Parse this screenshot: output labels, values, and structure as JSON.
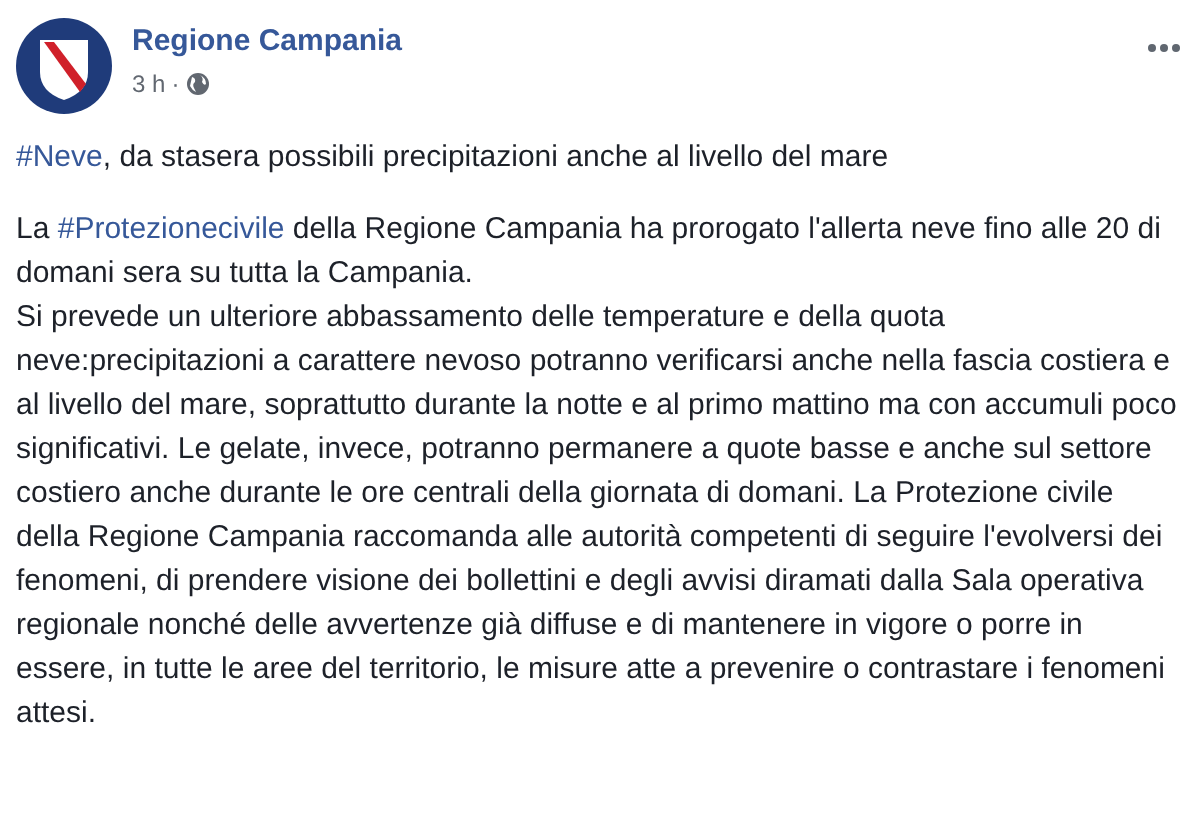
{
  "post": {
    "author": "Regione Campania",
    "time": "3 h",
    "separator": "·",
    "headline": {
      "hashtag": "#Neve",
      "text": ", da stasera possibili precipitazioni anche al livello del mare"
    },
    "paragraphs": [
      {
        "before": "La ",
        "hashtag": "#Protezionecivile",
        "after": " della Regione Campania ha prorogato l'allerta neve fino alle 20 di domani sera su tutta la Campania."
      },
      {
        "before": "Si prevede un ulteriore abbassamento delle temperature e della quota neve:precipitazioni a carattere nevoso potranno verificarsi anche nella fascia costiera e al livello del mare, soprattutto durante la notte e al primo mattino ma con accumuli poco significativi. Le gelate, invece, potranno permanere a quote basse e anche sul settore costiero anche durante le ore centrali della giornata di domani. La Protezione civile della Regione Campania raccomanda alle autorità competenti di seguire l'evolversi dei fenomeni, di prendere visione dei bollettini e degli avvisi diramati dalla Sala operativa regionale nonché delle avvertenze già diffuse e di mantenere in vigore o porre in essere, in tutte le aree del territorio, le misure atte a prevenire o contrastare i fenomeni attesi."
      }
    ]
  }
}
